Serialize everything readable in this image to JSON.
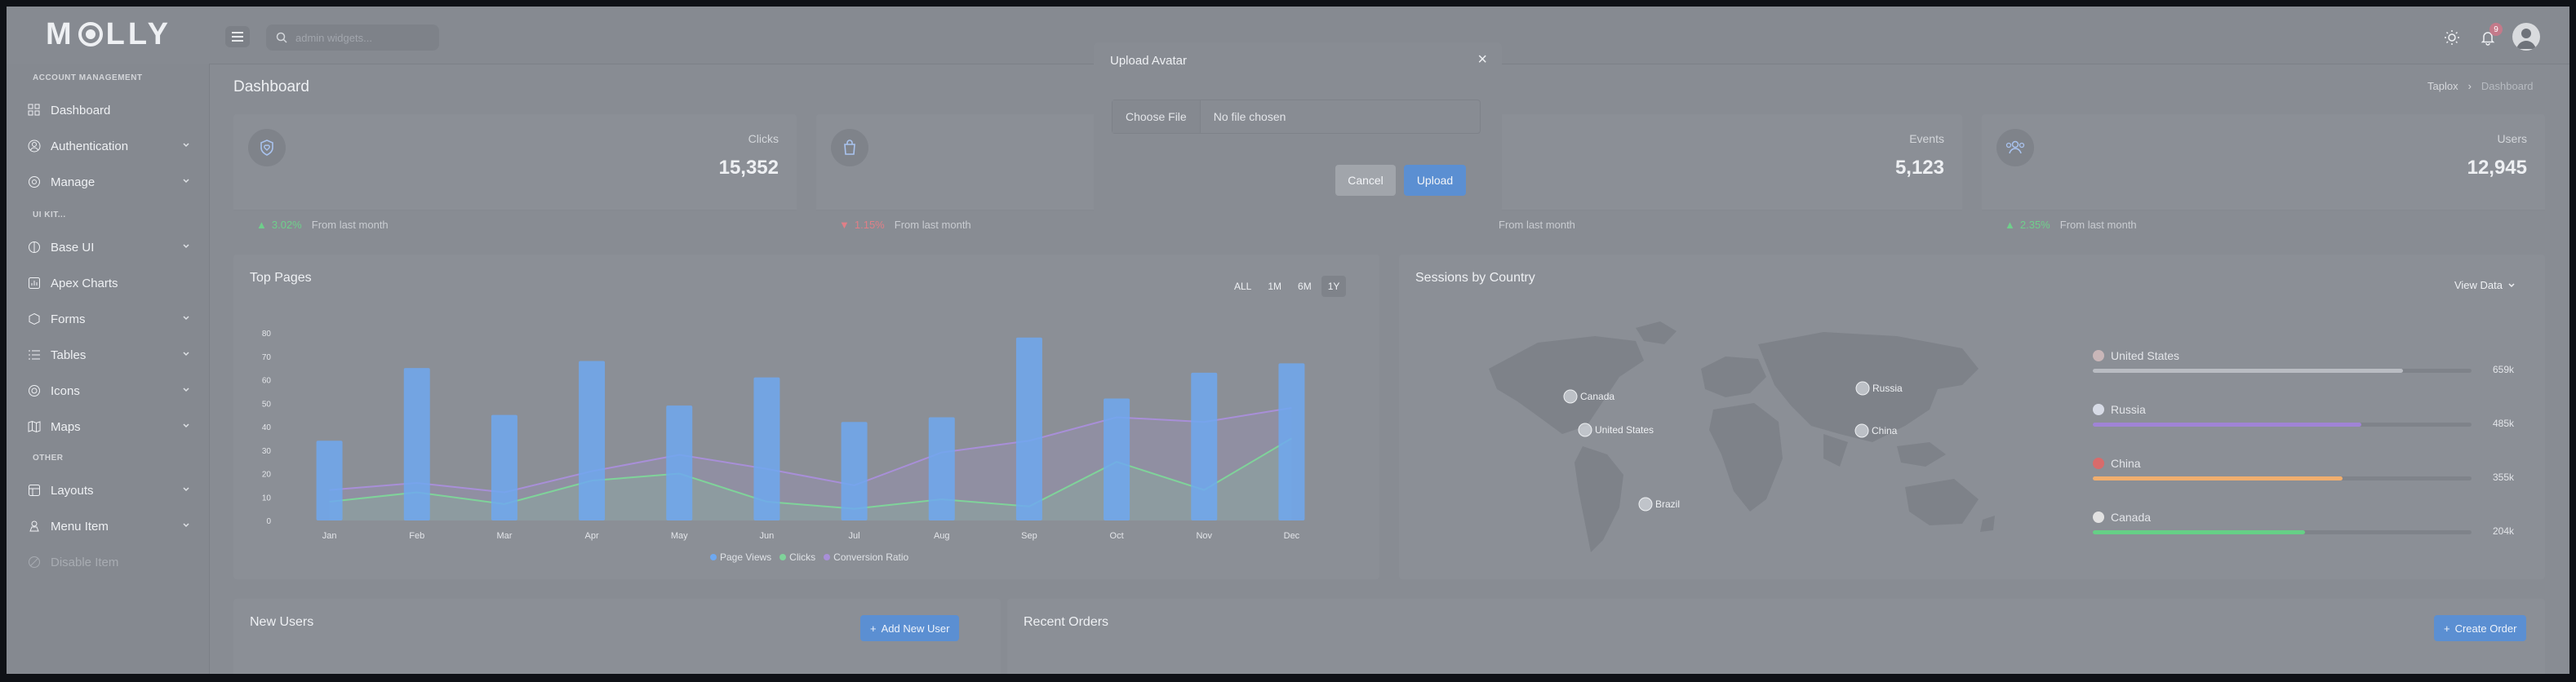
{
  "brand": {
    "logo_text": [
      "M",
      "LLY"
    ]
  },
  "topbar": {
    "search_placeholder": "admin widgets...",
    "notification_count": "9"
  },
  "sidebar": {
    "sections": {
      "account": "ACCOUNT MANAGEMENT",
      "ui_kit": "UI KIT...",
      "other": "OTHER"
    },
    "items": [
      {
        "label": "Dashboard",
        "icon": "grid-icon"
      },
      {
        "label": "Authentication",
        "icon": "user-circle-icon"
      },
      {
        "label": "Manage",
        "icon": "settings-icon"
      },
      {
        "label": "Base UI",
        "icon": "layers-icon"
      },
      {
        "label": "Apex Charts",
        "icon": "chart-icon"
      },
      {
        "label": "Forms",
        "icon": "box-icon"
      },
      {
        "label": "Tables",
        "icon": "list-icon"
      },
      {
        "label": "Icons",
        "icon": "target-icon"
      },
      {
        "label": "Maps",
        "icon": "map-icon"
      },
      {
        "label": "Layouts",
        "icon": "layout-icon"
      },
      {
        "label": "Menu Item",
        "icon": "menu-icon"
      },
      {
        "label": "Disable Item",
        "icon": "disabled-icon"
      }
    ]
  },
  "page": {
    "title": "Dashboard",
    "breadcrumb": {
      "root": "Taplox",
      "separator": "›",
      "current": "Dashboard"
    }
  },
  "stats": [
    {
      "label": "Clicks",
      "value": "15,352",
      "change": "3.02%",
      "trend": "up",
      "note": "From last month"
    },
    {
      "label": "",
      "value": "",
      "change": "1.15%",
      "trend": "down",
      "note": "From last month"
    },
    {
      "label": "Events",
      "value": "5,123",
      "change": "",
      "trend": "",
      "note": "From last month"
    },
    {
      "label": "Users",
      "value": "12,945",
      "change": "2.35%",
      "trend": "up",
      "note": "From last month"
    }
  ],
  "top_pages": {
    "title": "Top Pages",
    "ranges": [
      "ALL",
      "1M",
      "6M",
      "1Y"
    ],
    "active_range": "1Y"
  },
  "chart_data": {
    "type": "bar",
    "title": "Top Pages",
    "categories": [
      "Jan",
      "Feb",
      "Mar",
      "Apr",
      "May",
      "Jun",
      "Jul",
      "Aug",
      "Sep",
      "Oct",
      "Nov",
      "Dec"
    ],
    "yticks": [
      0,
      10,
      20,
      30,
      40,
      50,
      60,
      70,
      80
    ],
    "ylim": [
      0,
      80
    ],
    "series": [
      {
        "name": "Page Views",
        "type": "bar",
        "color": "#6ea8f0",
        "values": [
          34,
          65,
          45,
          68,
          49,
          61,
          42,
          44,
          78,
          52,
          63,
          67
        ]
      },
      {
        "name": "Clicks",
        "type": "area",
        "color": "#7fd39a",
        "values": [
          8,
          12,
          7,
          17,
          20,
          8,
          5,
          9,
          6,
          25,
          13,
          35
        ]
      },
      {
        "name": "Conversion Ratio",
        "type": "area",
        "color": "#a88fd8",
        "values": [
          13,
          16,
          12,
          21,
          28,
          22,
          15,
          29,
          34,
          44,
          42,
          48
        ]
      }
    ],
    "legend": "bottom"
  },
  "sessions": {
    "title": "Sessions by Country",
    "view_label": "View Data",
    "map_markers": [
      "Canada",
      "United States",
      "Russia",
      "China",
      "Brazil"
    ],
    "countries": [
      {
        "name": "United States",
        "value": "659k",
        "fraction": 0.82,
        "color": "#b9bcc2",
        "flag": "#c9b6b8"
      },
      {
        "name": "Russia",
        "value": "485k",
        "fraction": 0.71,
        "color": "#a084d6",
        "flag": "#d7dbe6"
      },
      {
        "name": "China",
        "value": "355k",
        "fraction": 0.66,
        "color": "#f0ae6e",
        "flag": "#d96b6b"
      },
      {
        "name": "Canada",
        "value": "204k",
        "fraction": 0.56,
        "color": "#66cf86",
        "flag": "#e2e2e2"
      }
    ]
  },
  "new_users": {
    "title": "New Users",
    "button": "Add New User"
  },
  "recent_orders": {
    "title": "Recent Orders",
    "button": "Create Order"
  },
  "modal": {
    "title": "Upload Avatar",
    "choose_label": "Choose File",
    "file_status": "No file chosen",
    "cancel": "Cancel",
    "upload": "Upload"
  }
}
